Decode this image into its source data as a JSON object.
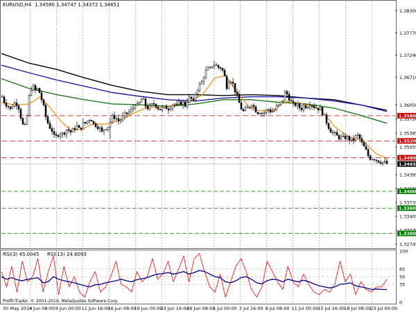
{
  "header": {
    "symbol": "EURUSD,H4",
    "ohlc": "1.34580 1.34747 1.34372 1.34651"
  },
  "indicator_header": {
    "rsi3": "RSI(3) 45.0045",
    "rsi13": "RSI(13) 24.6093"
  },
  "copyright": "Profit-Trader, © 2001-2014, MetaQuotes Software Corp.",
  "colors": {
    "candles": "#000000",
    "ma_fast": "#ff8c00",
    "ma_green": "#1a7a1a",
    "ma_blue": "#1f1fa8",
    "ma_black": "#000000",
    "resistance": "#cc0000",
    "support": "#008000",
    "rsi_fast": "#ff0000",
    "rsi_slow": "#00008b",
    "current_price": "#000000"
  },
  "chart_data": [
    {
      "type": "candlestick",
      "title": "EURUSD,H4",
      "x_ticks": [
        "30 May 2014",
        "4 Jun 08:00",
        "9 Jun 00:00",
        "11 Jun 16:00",
        "16 Jun 08:00",
        "19 Jun 00:00",
        "23 Jun 16:00",
        "26 Jun 08:00",
        "1 Jul 00:00",
        "3 Jul 16:00",
        "8 Jul 08:00",
        "11 Jul 00:00",
        "15 Jul 16:00",
        "18 Jul 08:00",
        "23 Jul 00:00"
      ],
      "y_ticks": [
        "1.38300",
        "1.37770",
        "1.37240",
        "1.36710",
        "1.36050",
        "1.35720",
        "1.35385",
        "1.35055",
        "1.34395",
        "1.34065",
        "1.33735",
        "1.33405",
        "1.33075",
        "1.32745"
      ],
      "ylim": [
        1.3268,
        1.3852
      ],
      "levels": [
        {
          "label": "1.35800",
          "value": 1.358,
          "kind": "resistance"
        },
        {
          "label": "1.35200",
          "value": 1.352,
          "kind": "resistance"
        },
        {
          "label": "1.34800",
          "value": 1.348,
          "kind": "resistance"
        },
        {
          "label": "1.34000",
          "value": 1.34,
          "kind": "support"
        },
        {
          "label": "1.33600",
          "value": 1.336,
          "kind": "support"
        },
        {
          "label": "1.33000",
          "value": 1.33,
          "kind": "support"
        }
      ],
      "current_price": {
        "label": "1.34651",
        "value": 1.34651
      },
      "close_path": [
        [
          0,
          1.3625
        ],
        [
          4,
          1.361
        ],
        [
          8,
          1.3605
        ],
        [
          12,
          1.3595
        ],
        [
          16,
          1.3608
        ],
        [
          20,
          1.3612
        ],
        [
          24,
          1.36
        ],
        [
          28,
          1.357
        ],
        [
          32,
          1.3545
        ],
        [
          36,
          1.358
        ],
        [
          40,
          1.364
        ],
        [
          44,
          1.365
        ],
        [
          48,
          1.364
        ],
        [
          52,
          1.3645
        ],
        [
          56,
          1.3625
        ],
        [
          60,
          1.36
        ],
        [
          64,
          1.357
        ],
        [
          68,
          1.3555
        ],
        [
          72,
          1.3545
        ],
        [
          76,
          1.3525
        ],
        [
          80,
          1.3535
        ],
        [
          84,
          1.354
        ],
        [
          88,
          1.3535
        ],
        [
          92,
          1.3548
        ],
        [
          96,
          1.3545
        ],
        [
          100,
          1.354
        ],
        [
          104,
          1.355
        ],
        [
          108,
          1.3555
        ],
        [
          112,
          1.3545
        ],
        [
          116,
          1.356
        ],
        [
          120,
          1.3562
        ],
        [
          124,
          1.357
        ],
        [
          128,
          1.3575
        ],
        [
          132,
          1.356
        ],
        [
          136,
          1.3558
        ],
        [
          140,
          1.3552
        ],
        [
          144,
          1.354
        ],
        [
          148,
          1.3552
        ],
        [
          152,
          1.3552
        ],
        [
          156,
          1.3565
        ],
        [
          160,
          1.358
        ],
        [
          164,
          1.3575
        ],
        [
          168,
          1.3568
        ],
        [
          172,
          1.3572
        ],
        [
          176,
          1.358
        ],
        [
          180,
          1.3585
        ],
        [
          184,
          1.359
        ],
        [
          188,
          1.3595
        ],
        [
          192,
          1.361
        ],
        [
          196,
          1.36
        ],
        [
          200,
          1.362
        ],
        [
          204,
          1.3615
        ],
        [
          208,
          1.36
        ],
        [
          212,
          1.3598
        ],
        [
          216,
          1.3605
        ],
        [
          220,
          1.361
        ],
        [
          224,
          1.36
        ],
        [
          228,
          1.3596
        ],
        [
          232,
          1.3598
        ],
        [
          236,
          1.36
        ],
        [
          240,
          1.3598
        ],
        [
          244,
          1.3605
        ],
        [
          248,
          1.361
        ],
        [
          252,
          1.3602
        ],
        [
          256,
          1.361
        ],
        [
          260,
          1.3612
        ],
        [
          264,
          1.3605
        ],
        [
          268,
          1.362
        ],
        [
          272,
          1.3622
        ],
        [
          276,
          1.3612
        ],
        [
          280,
          1.364
        ],
        [
          284,
          1.365
        ],
        [
          288,
          1.366
        ],
        [
          292,
          1.368
        ],
        [
          296,
          1.369
        ],
        [
          300,
          1.369
        ],
        [
          304,
          1.3705
        ],
        [
          308,
          1.37
        ],
        [
          312,
          1.3695
        ],
        [
          316,
          1.3695
        ],
        [
          320,
          1.368
        ],
        [
          324,
          1.365
        ],
        [
          328,
          1.367
        ],
        [
          332,
          1.366
        ],
        [
          336,
          1.364
        ],
        [
          340,
          1.362
        ],
        [
          344,
          1.36
        ],
        [
          348,
          1.359
        ],
        [
          352,
          1.3595
        ],
        [
          356,
          1.36
        ],
        [
          360,
          1.361
        ],
        [
          364,
          1.3598
        ],
        [
          368,
          1.3588
        ],
        [
          372,
          1.359
        ],
        [
          376,
          1.3586
        ],
        [
          380,
          1.359
        ],
        [
          384,
          1.3595
        ],
        [
          388,
          1.359
        ],
        [
          392,
          1.3592
        ],
        [
          396,
          1.36
        ],
        [
          400,
          1.3605
        ],
        [
          404,
          1.3615
        ],
        [
          408,
          1.3635
        ],
        [
          412,
          1.363
        ],
        [
          416,
          1.3615
        ],
        [
          420,
          1.3605
        ],
        [
          424,
          1.3608
        ],
        [
          428,
          1.36
        ],
        [
          432,
          1.3598
        ],
        [
          436,
          1.3605
        ],
        [
          440,
          1.3602
        ],
        [
          444,
          1.361
        ],
        [
          448,
          1.3605
        ],
        [
          452,
          1.36
        ],
        [
          456,
          1.3598
        ],
        [
          460,
          1.3595
        ],
        [
          464,
          1.358
        ],
        [
          468,
          1.3565
        ],
        [
          472,
          1.355
        ],
        [
          476,
          1.354
        ],
        [
          480,
          1.3535
        ],
        [
          484,
          1.353
        ],
        [
          488,
          1.3528
        ],
        [
          492,
          1.3526
        ],
        [
          496,
          1.353
        ],
        [
          500,
          1.3525
        ],
        [
          504,
          1.352
        ],
        [
          508,
          1.3525
        ],
        [
          512,
          1.3535
        ],
        [
          516,
          1.3525
        ],
        [
          520,
          1.351
        ],
        [
          524,
          1.35
        ],
        [
          528,
          1.3485
        ],
        [
          532,
          1.3478
        ],
        [
          536,
          1.348
        ],
        [
          540,
          1.3475
        ],
        [
          544,
          1.3472
        ],
        [
          548,
          1.347
        ],
        [
          552,
          1.3468
        ],
        [
          556,
          1.3465
        ]
      ],
      "ma_fast": [
        [
          0,
          1.3612
        ],
        [
          20,
          1.3605
        ],
        [
          40,
          1.3608
        ],
        [
          56,
          1.3625
        ],
        [
          70,
          1.36
        ],
        [
          84,
          1.357
        ],
        [
          100,
          1.3545
        ],
        [
          116,
          1.3548
        ],
        [
          132,
          1.356
        ],
        [
          150,
          1.356
        ],
        [
          170,
          1.3568
        ],
        [
          190,
          1.3585
        ],
        [
          210,
          1.36
        ],
        [
          230,
          1.36
        ],
        [
          250,
          1.3605
        ],
        [
          270,
          1.3612
        ],
        [
          290,
          1.363
        ],
        [
          308,
          1.367
        ],
        [
          324,
          1.3675
        ],
        [
          340,
          1.3635
        ],
        [
          356,
          1.3603
        ],
        [
          372,
          1.3592
        ],
        [
          392,
          1.3592
        ],
        [
          408,
          1.3615
        ],
        [
          424,
          1.361
        ],
        [
          444,
          1.3605
        ],
        [
          462,
          1.3592
        ],
        [
          480,
          1.3555
        ],
        [
          500,
          1.353
        ],
        [
          520,
          1.3522
        ],
        [
          540,
          1.349
        ],
        [
          556,
          1.3478
        ]
      ],
      "ma_green": [
        [
          0,
          1.3668
        ],
        [
          40,
          1.3645
        ],
        [
          80,
          1.363
        ],
        [
          120,
          1.3618
        ],
        [
          160,
          1.3608
        ],
        [
          200,
          1.3606
        ],
        [
          240,
          1.3602
        ],
        [
          280,
          1.3608
        ],
        [
          320,
          1.3618
        ],
        [
          360,
          1.3618
        ],
        [
          400,
          1.3612
        ],
        [
          440,
          1.3608
        ],
        [
          480,
          1.3598
        ],
        [
          520,
          1.358
        ],
        [
          556,
          1.3562
        ]
      ],
      "ma_blue": [
        [
          0,
          1.37
        ],
        [
          40,
          1.3682
        ],
        [
          80,
          1.3665
        ],
        [
          120,
          1.365
        ],
        [
          160,
          1.3635
        ],
        [
          200,
          1.3626
        ],
        [
          240,
          1.3618
        ],
        [
          280,
          1.3615
        ],
        [
          320,
          1.3622
        ],
        [
          360,
          1.3625
        ],
        [
          400,
          1.3625
        ],
        [
          440,
          1.3622
        ],
        [
          480,
          1.3615
        ],
        [
          520,
          1.3605
        ],
        [
          556,
          1.359
        ]
      ],
      "ma_black": [
        [
          0,
          1.3728
        ],
        [
          40,
          1.3705
        ],
        [
          80,
          1.369
        ],
        [
          120,
          1.367
        ],
        [
          160,
          1.3652
        ],
        [
          200,
          1.3638
        ],
        [
          240,
          1.363
        ],
        [
          280,
          1.363
        ],
        [
          320,
          1.3628
        ],
        [
          360,
          1.363
        ],
        [
          400,
          1.3628
        ],
        [
          440,
          1.3622
        ],
        [
          480,
          1.3618
        ],
        [
          520,
          1.3605
        ],
        [
          556,
          1.3593
        ]
      ]
    },
    {
      "type": "line",
      "title": "RSI(3) 45.0045 RSI(13) 24.6093",
      "y_ticks": [
        "100",
        "65",
        "50",
        "35",
        "0"
      ],
      "ylim": [
        0,
        100
      ],
      "series": [
        {
          "name": "RSI(3)",
          "values": [
            60,
            30,
            70,
            20,
            80,
            40,
            50,
            85,
            20,
            60,
            90,
            15,
            70,
            30,
            50,
            20,
            10,
            40,
            60,
            20,
            30,
            50,
            80,
            35,
            30,
            20,
            60,
            40,
            50,
            85,
            45,
            55,
            80,
            40,
            65,
            90,
            40,
            85,
            95,
            60,
            30,
            20,
            55,
            10,
            40,
            70,
            85,
            60,
            25,
            10,
            30,
            80,
            60,
            40,
            25,
            70,
            40,
            30,
            55,
            35,
            20,
            15,
            25,
            20,
            35,
            80,
            40,
            55,
            15,
            40,
            25,
            20,
            30,
            30,
            45
          ]
        },
        {
          "name": "RSI(13)",
          "values": [
            50,
            45,
            48,
            44,
            42,
            45,
            46,
            48,
            38,
            40,
            50,
            45,
            42,
            40,
            38,
            35,
            32,
            30,
            34,
            35,
            38,
            40,
            42,
            45,
            42,
            40,
            44,
            46,
            48,
            52,
            55,
            56,
            58,
            55,
            57,
            60,
            55,
            58,
            62,
            60,
            55,
            50,
            48,
            40,
            38,
            42,
            48,
            50,
            45,
            38,
            36,
            42,
            45,
            44,
            40,
            45,
            42,
            40,
            43,
            40,
            36,
            32,
            30,
            28,
            30,
            35,
            36,
            38,
            32,
            30,
            28,
            25,
            26,
            25,
            25
          ]
        }
      ]
    }
  ]
}
